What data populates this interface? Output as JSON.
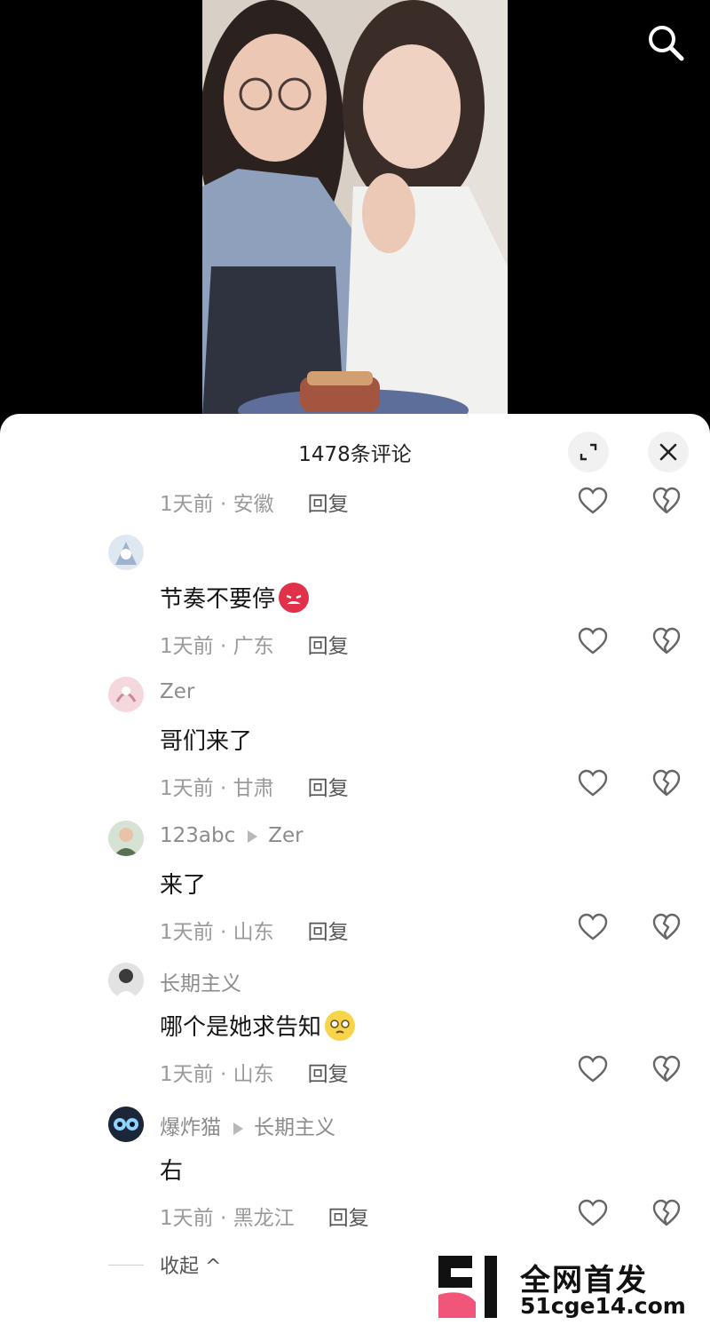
{
  "header": {
    "comment_count_title": "1478条评论"
  },
  "comments": [
    {
      "time_location": "1天前 · 安徽",
      "reply_label": "回复"
    },
    {
      "username": "",
      "text": "节奏不要停",
      "emoji": "angry-devil-emoji",
      "time_location": "1天前 · 广东",
      "reply_label": "回复"
    },
    {
      "username": "Zer",
      "text": "哥们来了",
      "time_location": "1天前 · 甘肃",
      "reply_label": "回复"
    },
    {
      "username": "123abc",
      "reply_to": "Zer",
      "text": "来了",
      "time_location": "1天前 · 山东",
      "reply_label": "回复"
    },
    {
      "username": "长期主义",
      "text": "哪个是她求告知",
      "emoji": "pleading-face-emoji",
      "time_location": "1天前 · 山东",
      "reply_label": "回复"
    },
    {
      "username": "爆炸猫",
      "reply_to": "长期主义",
      "text": "右",
      "time_location": "1天前 · 黑龙江",
      "reply_label": "回复"
    }
  ],
  "collapse_label": "收起 ^",
  "watermark": {
    "title": "全网首发",
    "url": "51cge14.com"
  },
  "icons": {
    "search": "search-icon",
    "expand": "expand-icon",
    "close": "close-icon",
    "like": "heart-icon",
    "dislike": "broken-heart-icon"
  },
  "colors": {
    "sheet_bg": "#ffffff",
    "secondary_text": "#9a9a9a",
    "watermark_pink": "#f2557a"
  }
}
